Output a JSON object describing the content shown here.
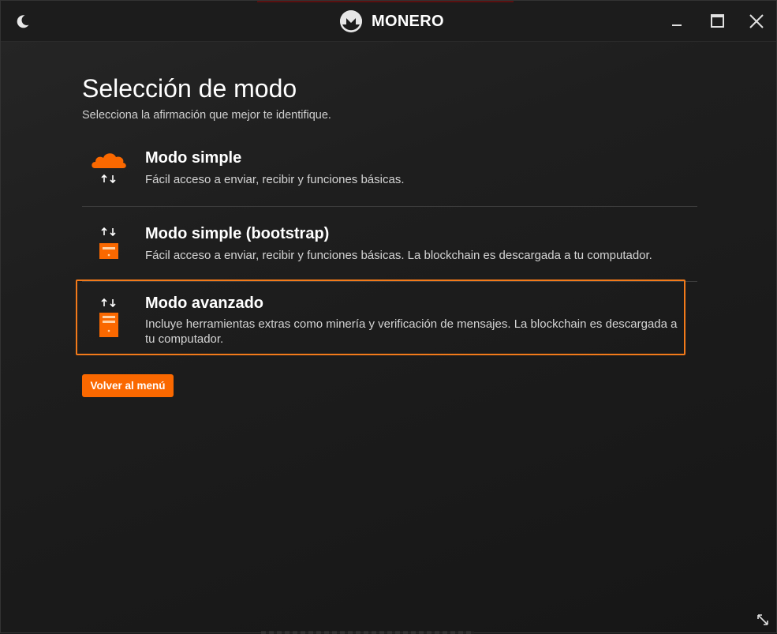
{
  "app": {
    "title": "MONERO",
    "theme_icon": "moon-icon",
    "accent_color": "#fa6800",
    "highlight_color": "#f27a1a"
  },
  "window_controls": {
    "minimize_icon": "minimize-icon",
    "maximize_icon": "maximize-icon",
    "close_icon": "close-icon"
  },
  "page": {
    "title": "Selección de modo",
    "subtitle": "Selecciona la afirmación que mejor te identifique."
  },
  "modes": [
    {
      "id": "simple",
      "title": "Modo simple",
      "description": "Fácil acceso a enviar, recibir y funciones básicas.",
      "icon": "cloud-transfer-icon",
      "selected": false
    },
    {
      "id": "bootstrap",
      "title": "Modo simple (bootstrap)",
      "description": "Fácil acceso a enviar, recibir y funciones básicas. La blockchain es descargada a tu computador.",
      "icon": "small-server-transfer-icon",
      "selected": false
    },
    {
      "id": "advanced",
      "title": "Modo avanzado",
      "description": "Incluye herramientas extras como minería y verificación de mensajes. La blockchain es descargada a tu computador.",
      "icon": "server-transfer-icon",
      "selected": true
    }
  ],
  "actions": {
    "back_label": "Volver al menú"
  },
  "footer": {
    "resize_icon": "resize-icon"
  }
}
